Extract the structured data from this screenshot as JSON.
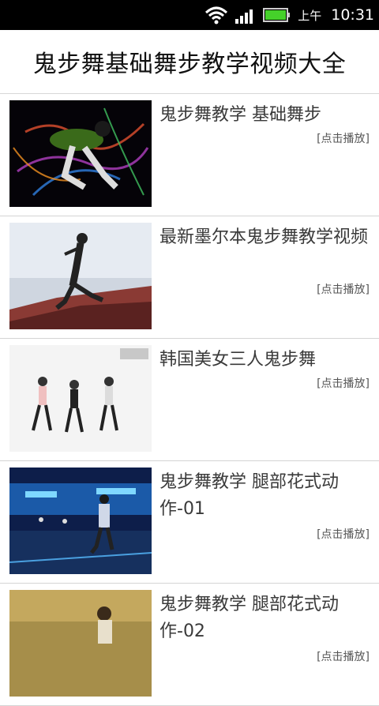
{
  "status_bar": {
    "ampm": "上午",
    "time": "10:31",
    "icons": [
      "wifi-icon",
      "signal-icon",
      "battery-icon"
    ]
  },
  "header": {
    "title": "鬼步舞基础舞步教学视频大全"
  },
  "videos": [
    {
      "title": "鬼步舞教学 基础舞步",
      "play_label": "[点击播放]"
    },
    {
      "title": "最新墨尔本鬼步舞教学视频",
      "play_label": "[点击播放]"
    },
    {
      "title": "韩国美女三人鬼步舞",
      "play_label": "[点击播放]"
    },
    {
      "title": "鬼步舞教学 腿部花式动作-01",
      "play_label": "[点击播放]"
    },
    {
      "title": "鬼步舞教学 腿部花式动作-02",
      "play_label": "[点击播放]"
    }
  ],
  "colors": {
    "status_bg": "#000000",
    "battery": "#45d12a",
    "divider": "#d4d4d4"
  }
}
